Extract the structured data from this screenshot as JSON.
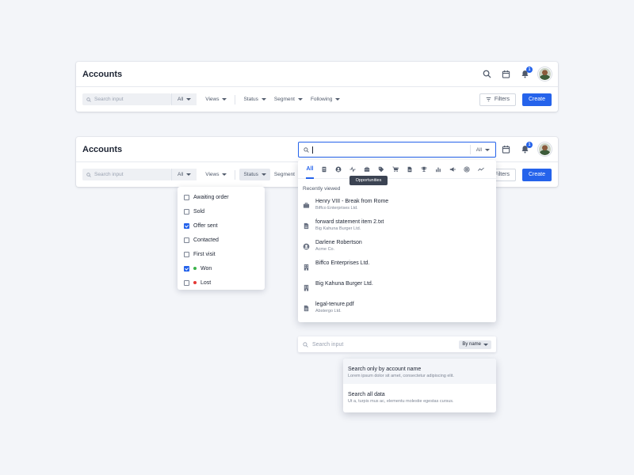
{
  "header": {
    "title": "Accounts",
    "notification_count": "1"
  },
  "toolbar": {
    "search_placeholder": "Search input",
    "all_label": "All",
    "views_label": "Views",
    "status_label": "Status",
    "segment_label": "Segment",
    "following_label": "Following",
    "filters_label": "Filters",
    "create_label": "Create"
  },
  "status_menu": {
    "items": [
      {
        "label": "Awaiting order",
        "checked": false
      },
      {
        "label": "Sold",
        "checked": false
      },
      {
        "label": "Offer sent",
        "checked": true
      },
      {
        "label": "Contacted",
        "checked": false
      },
      {
        "label": "First visit",
        "checked": false
      },
      {
        "label": "Won",
        "checked": true,
        "dot": "#3bb34a"
      },
      {
        "label": "Lost",
        "checked": false,
        "dot": "#e53935"
      }
    ]
  },
  "global_search": {
    "all_label": "All",
    "tabs": [
      {
        "label": "All",
        "icon": "all"
      },
      {
        "icon": "document-icon"
      },
      {
        "icon": "person-icon"
      },
      {
        "icon": "activity-icon"
      },
      {
        "icon": "briefcase-icon"
      },
      {
        "icon": "tag-icon"
      },
      {
        "icon": "cart-icon"
      },
      {
        "icon": "file-icon"
      },
      {
        "icon": "trophy-icon"
      },
      {
        "icon": "bar-chart-icon"
      },
      {
        "icon": "megaphone-icon"
      },
      {
        "icon": "target-icon"
      },
      {
        "icon": "trend-icon"
      }
    ],
    "tooltip": "Opportunities",
    "section_title": "Recently viewed",
    "results": [
      {
        "icon": "briefcase-icon",
        "name": "Henry VIII - Break from Rome",
        "sub": "Biffco Enterprises Ltd."
      },
      {
        "icon": "file-icon",
        "name": "forward statement item 2.txt",
        "sub": "Big Kahuna Burger Ltd."
      },
      {
        "icon": "person-icon",
        "name": "Darlene Robertson",
        "sub": "Acme Co."
      },
      {
        "icon": "building-icon",
        "name": "Biffco Enterprises Ltd.",
        "sub": ""
      },
      {
        "icon": "building-icon",
        "name": "Big Kahuna Burger Ltd.",
        "sub": ""
      },
      {
        "icon": "file-icon",
        "name": "legal-tenure.pdf",
        "sub": "Abstergo Ltd."
      }
    ]
  },
  "by_name_search": {
    "placeholder": "Search input",
    "select_label": "By name",
    "options": [
      {
        "title": "Search only by account name",
        "desc": "Lorem ipsum dolor sit amet, consectetur adipiscing elit."
      },
      {
        "title": "Search all data",
        "desc": "Ut a, turpis mus ac, elementu molestie egestas cursus."
      }
    ]
  },
  "colors": {
    "accent": "#2563eb",
    "won": "#3bb34a",
    "lost": "#e53935"
  }
}
